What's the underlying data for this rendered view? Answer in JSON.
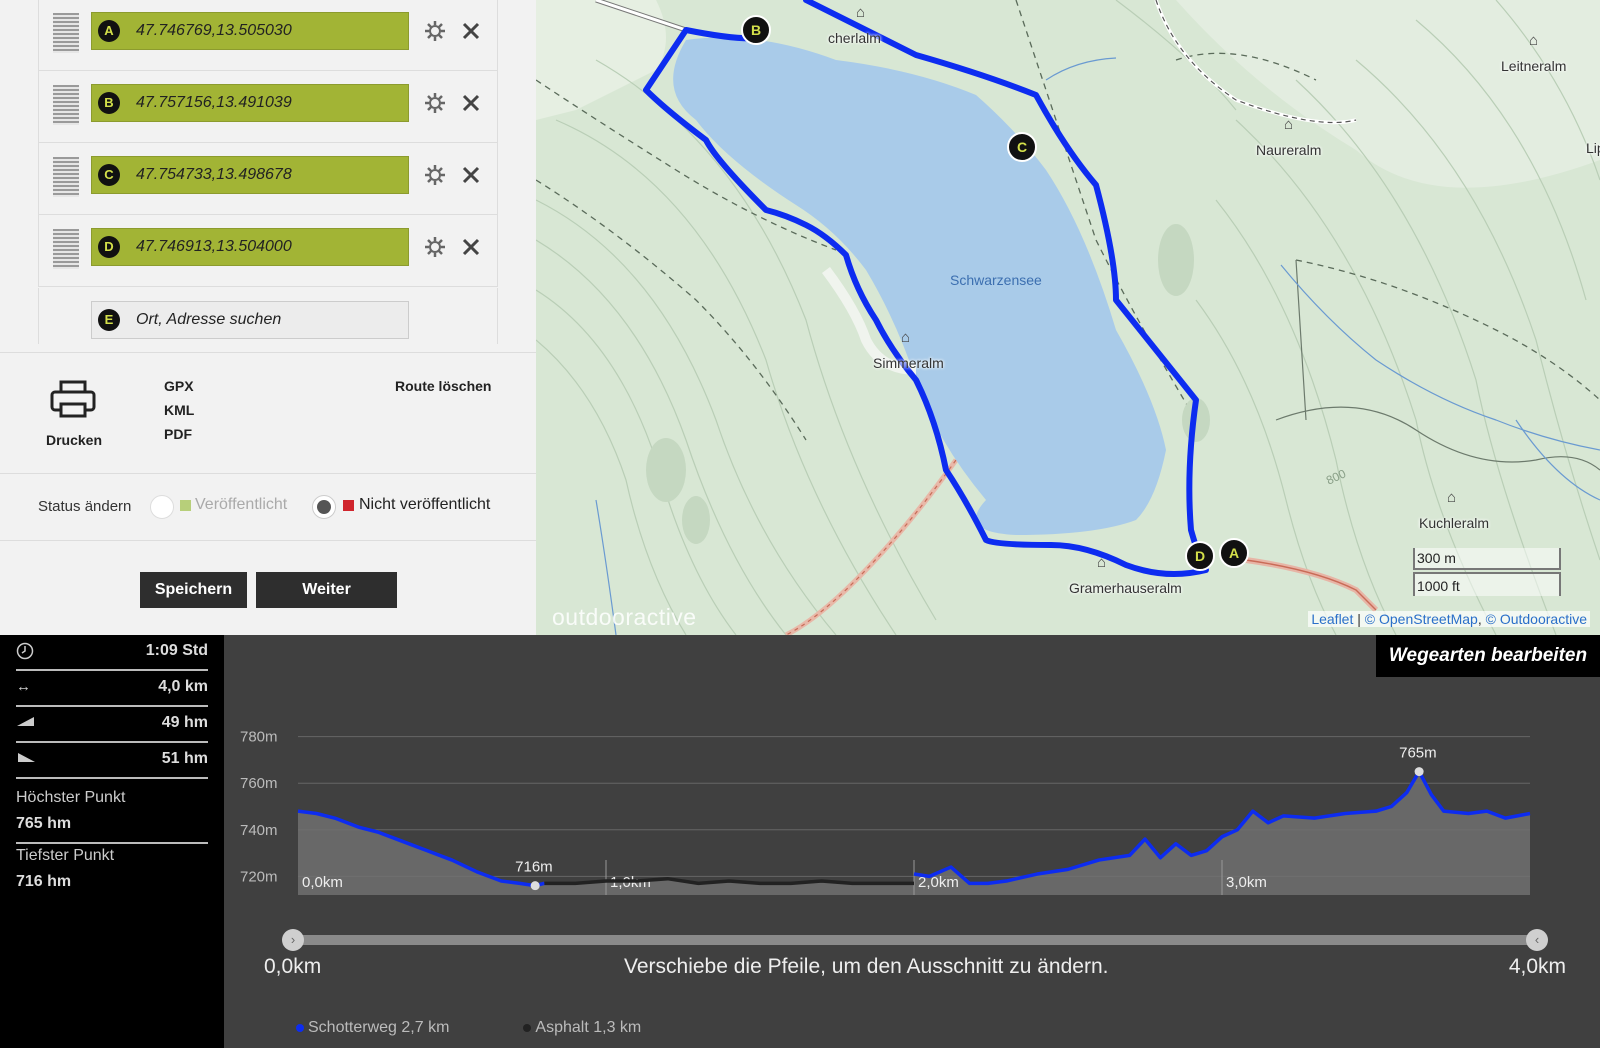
{
  "waypoints": [
    {
      "letter": "A",
      "value": "47.746769,13.505030"
    },
    {
      "letter": "B",
      "value": "47.757156,13.491039"
    },
    {
      "letter": "C",
      "value": "47.754733,13.498678"
    },
    {
      "letter": "D",
      "value": "47.746913,13.504000"
    }
  ],
  "search": {
    "letter": "E",
    "placeholder": "Ort, Adresse suchen"
  },
  "actions": {
    "print": "Drucken",
    "gpx": "GPX",
    "kml": "KML",
    "pdf": "PDF",
    "delete_route": "Route löschen"
  },
  "status": {
    "label": "Status ändern",
    "published": "Veröffentlicht",
    "unpublished": "Nicht veröffentlicht",
    "selected": "unpublished",
    "published_color": "#b7cf7a",
    "unpublished_color": "#d0252d"
  },
  "buttons": {
    "save": "Speichern",
    "next": "Weiter"
  },
  "map": {
    "lake_name": "Schwarzensee",
    "places": [
      "Eibl-/Fischerlalm",
      "Leitneralm",
      "Naureralm",
      "Simmeralm",
      "Gramerhauseralm",
      "Kuchleralm",
      "Lipp"
    ],
    "places_visible": [
      "cherlalm",
      "Leitneralm",
      "Naureralm",
      "Simmeralm",
      "Gramerhauseralm",
      "Kuchleralm",
      "Lip"
    ],
    "contour_label": "800",
    "markers": [
      "A",
      "B",
      "C",
      "D"
    ],
    "scale": {
      "metric": "300 m",
      "imperial": "1000 ft"
    },
    "logo": "outdooractive",
    "attribution": {
      "leaflet": "Leaflet",
      "sep": " | ",
      "osm": "© OpenStreetMap",
      "comma": ", ",
      "oa": "© Outdooractive"
    },
    "route_color": "#0d2cf0",
    "lake_color": "#a9cbe9"
  },
  "stats": {
    "duration": "1:09 Std",
    "distance": "4,0 km",
    "ascent": "49 hm",
    "descent": "51 hm",
    "highest_label": "Höchster Punkt",
    "highest_value": "765 hm",
    "lowest_label": "Tiefster Punkt",
    "lowest_value": "716 hm"
  },
  "profile": {
    "edit_button": "Wegearten bearbeiten",
    "range_start": "0,0km",
    "range_end": "4,0km",
    "hint": "Verschiebe die Pfeile, um den Ausschnitt zu ändern.",
    "legend": [
      {
        "label": "Schotterweg 2,7 km",
        "color": "#0d2cf0"
      },
      {
        "label": "Asphalt 1,3 km",
        "color": "#222222"
      }
    ]
  },
  "chart_data": {
    "type": "area",
    "title": "",
    "xlabel": "",
    "ylabel": "",
    "x_unit": "km",
    "y_unit": "m",
    "xlim": [
      0,
      4.0
    ],
    "ylim": [
      712,
      785
    ],
    "y_ticks": [
      "720m",
      "740m",
      "760m",
      "780m"
    ],
    "y_tick_values": [
      720,
      740,
      760,
      780
    ],
    "x_ticks": [
      "0,0km",
      "1,0km",
      "2,0km",
      "3,0km"
    ],
    "x_tick_values": [
      0,
      1,
      2,
      3
    ],
    "grid": true,
    "annotations": [
      {
        "label": "716m",
        "x": 0.77,
        "y": 716
      },
      {
        "label": "765m",
        "x": 3.64,
        "y": 765
      }
    ],
    "series": [
      {
        "name": "Schotterweg",
        "color": "#0d2cf0",
        "x": [
          0.0,
          0.06,
          0.12,
          0.2,
          0.26,
          0.34,
          0.42,
          0.5,
          0.58,
          0.66,
          0.72,
          0.77,
          0.8
        ],
        "y": [
          748,
          747,
          745,
          741,
          739,
          735,
          731,
          727,
          722,
          718,
          717,
          716,
          717
        ]
      },
      {
        "name": "Asphalt",
        "color": "#222222",
        "x": [
          0.8,
          0.9,
          1.0,
          1.1,
          1.2,
          1.3,
          1.4,
          1.5,
          1.6,
          1.7,
          1.8,
          1.9,
          2.0
        ],
        "y": [
          717,
          717,
          718,
          718,
          719,
          717,
          718,
          717,
          717,
          718,
          717,
          717,
          717
        ]
      },
      {
        "name": "Schotterweg",
        "color": "#0d2cf0",
        "x": [
          2.0,
          2.05,
          2.12,
          2.18,
          2.24,
          2.3,
          2.4,
          2.5,
          2.6,
          2.7,
          2.75,
          2.8,
          2.85,
          2.9,
          2.95,
          3.0,
          3.05,
          3.1,
          3.15,
          3.2,
          3.3,
          3.4,
          3.5,
          3.55,
          3.6,
          3.64,
          3.68,
          3.72,
          3.8,
          3.86,
          3.92,
          4.0
        ],
        "y": [
          721,
          720,
          724,
          717,
          717,
          718,
          721,
          723,
          727,
          729,
          736,
          728,
          734,
          729,
          731,
          737,
          740,
          748,
          743,
          746,
          745,
          747,
          748,
          750,
          756,
          765,
          755,
          748,
          747,
          748,
          745,
          747
        ]
      }
    ]
  }
}
